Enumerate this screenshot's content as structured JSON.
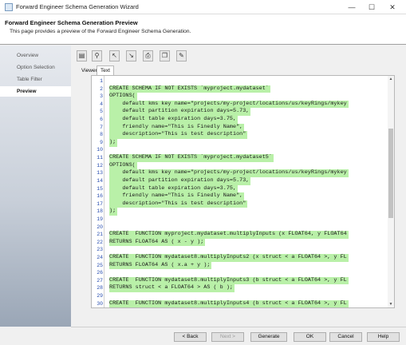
{
  "window": {
    "title": "Forward Engineer Schema Generation Wizard",
    "minimize_glyph": "—",
    "maximize_glyph": "☐",
    "close_glyph": "✕"
  },
  "header": {
    "title": "Forward Engineer Schema Generation Preview",
    "description": "This page provides a preview of the Forward Engineer Schema Generation."
  },
  "sidebar": {
    "items": [
      {
        "label": "Overview"
      },
      {
        "label": "Option Selection"
      },
      {
        "label": "Table Filter"
      },
      {
        "label": "Preview"
      }
    ]
  },
  "toolbar": {
    "icons": [
      "save-icon",
      "find-icon",
      "find-previous-icon",
      "find-next-icon",
      "print-icon",
      "copy-icon",
      "edit-icon"
    ]
  },
  "tabs": [
    {
      "label": "Viewer"
    },
    {
      "label": "Text"
    }
  ],
  "editor": {
    "lines": [
      {
        "n": "1",
        "text": ""
      },
      {
        "n": "2",
        "text": "CREATE SCHEMA IF NOT EXISTS `myproject.mydataset`"
      },
      {
        "n": "3",
        "text": "OPTIONS("
      },
      {
        "n": "4",
        "text": "    default kms key name=\"projects/my-project/locations/us/keyRings/mykey"
      },
      {
        "n": "5",
        "text": "    default partition expiration days=5.73,"
      },
      {
        "n": "6",
        "text": "    default table expiration days=3.75,"
      },
      {
        "n": "7",
        "text": "    friendly name=\"This is Finedly Name\","
      },
      {
        "n": "8",
        "text": "    description=\"This is test description\""
      },
      {
        "n": "9",
        "text": ");"
      },
      {
        "n": "10",
        "text": ""
      },
      {
        "n": "11",
        "text": "CREATE SCHEMA IF NOT EXISTS `myproject.mydataset5`"
      },
      {
        "n": "12",
        "text": "OPTIONS("
      },
      {
        "n": "13",
        "text": "    default kms key name=\"projects/my-project/locations/us/keyRings/mykey"
      },
      {
        "n": "14",
        "text": "    default partition expiration days=5.73,"
      },
      {
        "n": "15",
        "text": "    default table expiration days=3.75,"
      },
      {
        "n": "16",
        "text": "    friendly name=\"This is Finedly Name\","
      },
      {
        "n": "17",
        "text": "    description=\"This is test description\""
      },
      {
        "n": "18",
        "text": ");"
      },
      {
        "n": "19",
        "text": ""
      },
      {
        "n": "20",
        "text": ""
      },
      {
        "n": "21",
        "text": "CREATE  FUNCTION myproject.mydataset.multiplyInputs (x FLOAT64, y FLOAT64"
      },
      {
        "n": "22",
        "text": "RETURNS FLOAT64 AS ( x - y );"
      },
      {
        "n": "23",
        "text": ""
      },
      {
        "n": "24",
        "text": "CREATE  FUNCTION mydataset8.multiplyInputs2 (x struct < a FLOAT64 >, y FL"
      },
      {
        "n": "25",
        "text": "RETURNS FLOAT64 AS ( x.a + y );"
      },
      {
        "n": "26",
        "text": ""
      },
      {
        "n": "27",
        "text": "CREATE  FUNCTION mydataset8.multiplyInputs3 (b struct < a FLOAT64 >, y FL"
      },
      {
        "n": "28",
        "text": "RETURNS struct < a FLOAT64 > AS ( b );"
      },
      {
        "n": "29",
        "text": ""
      },
      {
        "n": "30",
        "text": "CREATE  FUNCTION mydataset8.multiplyInputs4 (b struct < a FLOAT64 >, y FL"
      }
    ],
    "highlight_color": "#b9f0a8"
  },
  "scrollbar": {
    "up_glyph": "▲",
    "down_glyph": "▼"
  },
  "buttons": {
    "back": "< Back",
    "next": "Next >",
    "generate": "Generate",
    "ok": "OK",
    "cancel": "Cancel",
    "help": "Help"
  }
}
